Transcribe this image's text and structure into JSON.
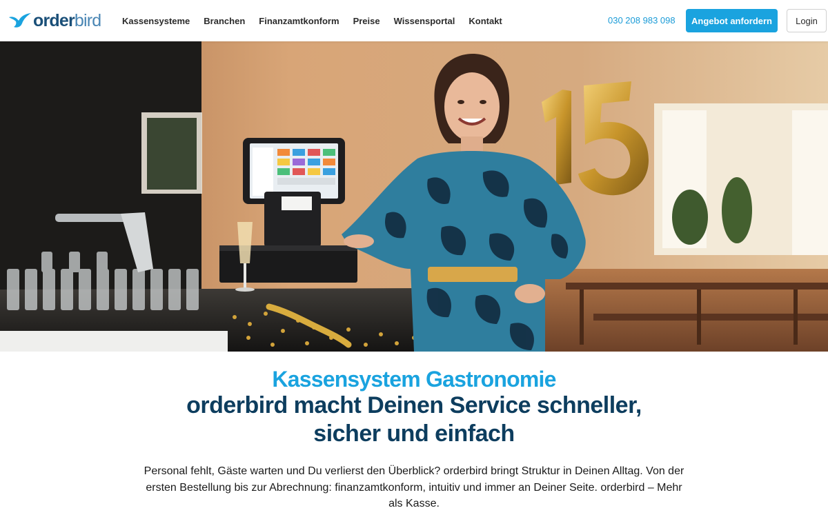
{
  "brand": {
    "logo_bold": "order",
    "logo_light": "bird",
    "logo_color": "#1a4f78",
    "accent_color": "#1aa3df",
    "heading_color": "#0d3d5e"
  },
  "nav": {
    "items": [
      {
        "label": "Kassensysteme"
      },
      {
        "label": "Branchen"
      },
      {
        "label": "Finanzamtkonform"
      },
      {
        "label": "Preise"
      },
      {
        "label": "Wissensportal"
      },
      {
        "label": "Kontakt"
      }
    ]
  },
  "header": {
    "phone": "030 208 983 098",
    "cta_label": "Angebot anfordern",
    "login_label": "Login"
  },
  "hero": {
    "balloon_number": "15",
    "balloon_color": "#d9a930",
    "dress_color": "#2f7e9e"
  },
  "main": {
    "headline_accent": "Kassensystem Gastronomie",
    "headline_line1": "orderbird macht Deinen Service schneller,",
    "headline_line2": "sicher und einfach",
    "intro": "Personal fehlt, Gäste warten und Du verlierst den Überblick? orderbird bringt Struktur in Deinen Alltag. Von der ersten Bestellung bis zur Abrechnung: finanzamtkonform, intuitiv und immer an Deiner Seite. orderbird – Mehr als Kasse."
  }
}
